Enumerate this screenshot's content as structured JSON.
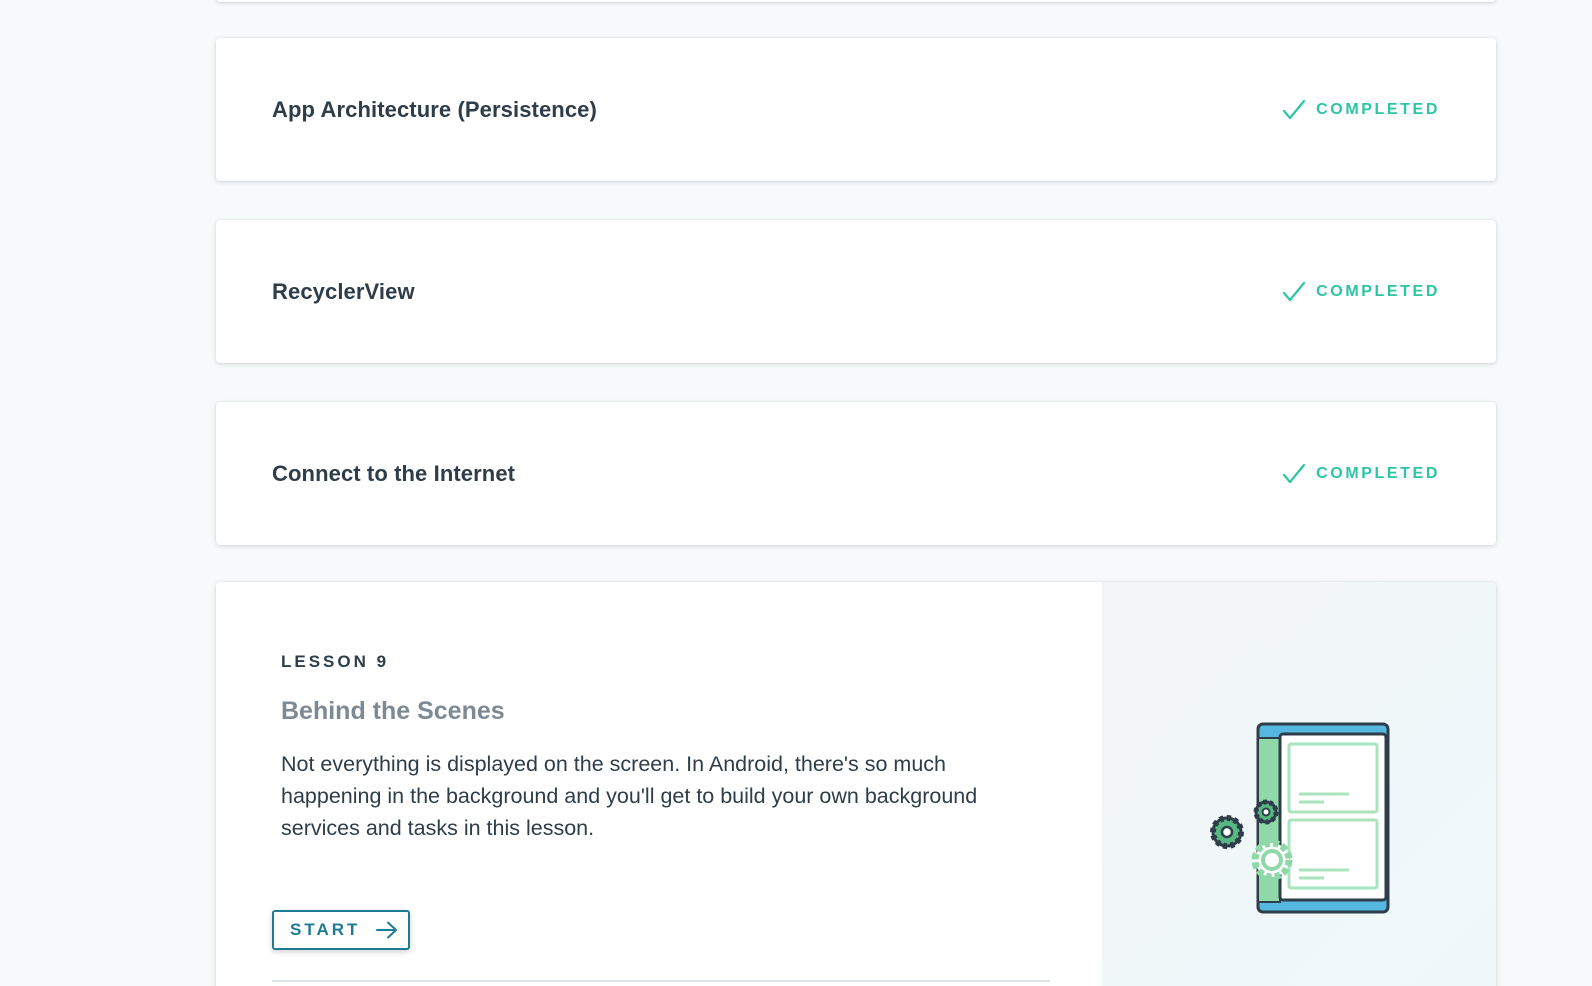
{
  "lessons": [
    {
      "title": "App Architecture (Persistence)",
      "status": "COMPLETED"
    },
    {
      "title": "RecyclerView",
      "status": "COMPLETED"
    },
    {
      "title": "Connect to the Internet",
      "status": "COMPLETED"
    }
  ],
  "featured": {
    "label": "LESSON 9",
    "title": "Behind the Scenes",
    "description": "Not everything is displayed on the screen. In Android, there's so much happening in the background and you'll get to build your own background services and tasks in this lesson.",
    "start_label": "START",
    "illustration": "phone-with-gears-illustration"
  },
  "icons": {
    "status": "check-icon",
    "start": "arrow-right-icon"
  },
  "colors": {
    "completed": "#2cc5a3",
    "accent": "#1d7c93",
    "text": "#2e3d49",
    "muted_title": "#7d8a95",
    "background": "#f7f9fa"
  }
}
